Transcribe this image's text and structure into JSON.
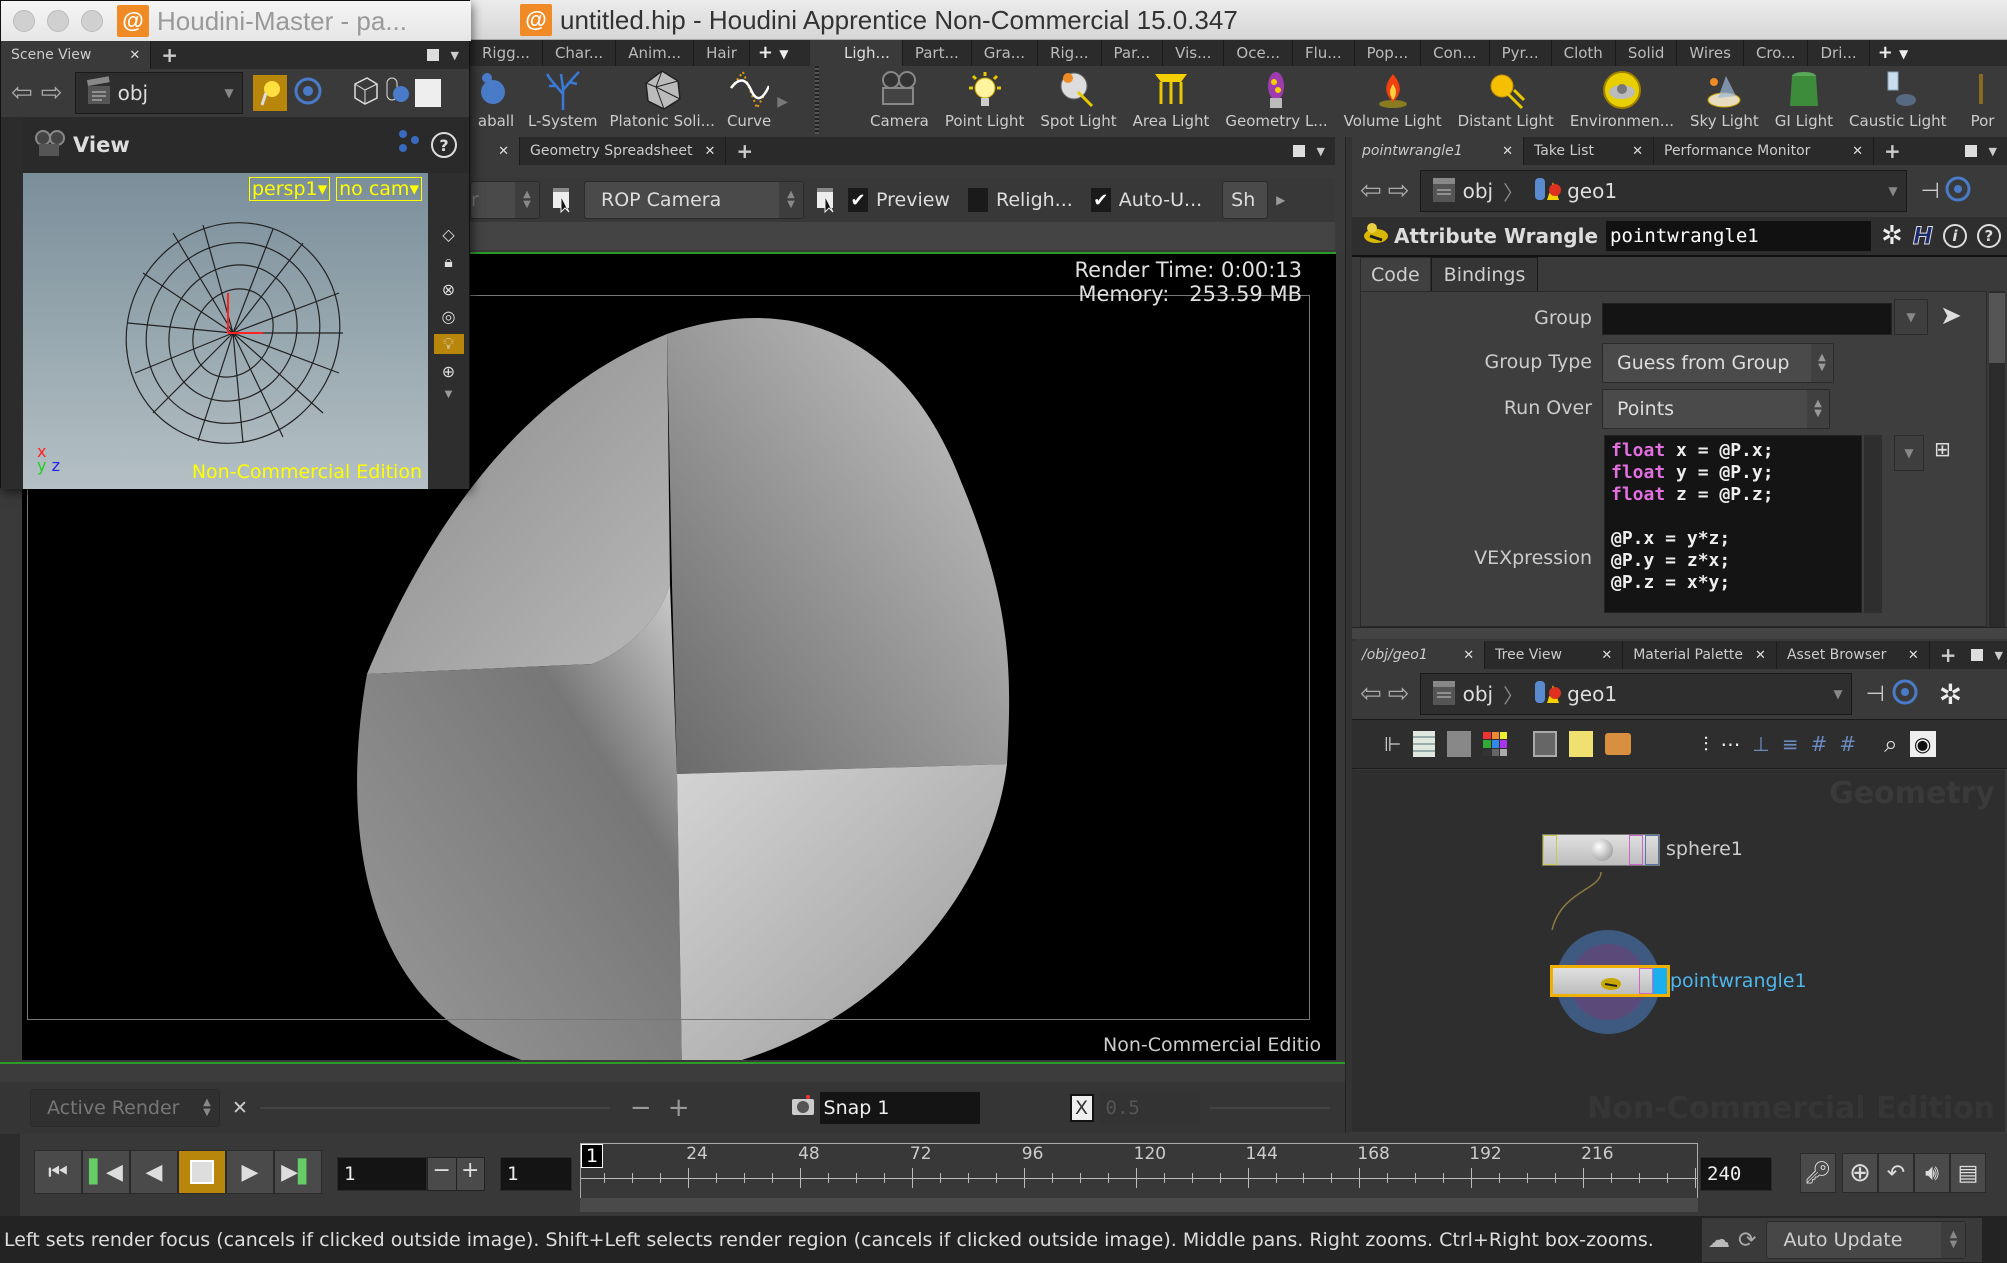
{
  "window": {
    "title": "untitled.hip - Houdini Apprentice Non-Commercial 15.0.347",
    "floating_title": "Houdini-Master - pa..."
  },
  "shelf_left": {
    "tabs": [
      "Rigg...",
      "Char...",
      "Anim...",
      "Hair"
    ],
    "tools": [
      {
        "label": "aball",
        "icon": "metaball-icon"
      },
      {
        "label": "L-System",
        "icon": "lsystem-icon"
      },
      {
        "label": "Platonic Soli...",
        "icon": "platonic-icon"
      },
      {
        "label": "Curve",
        "icon": "curve-icon"
      }
    ]
  },
  "shelf_right": {
    "tabs": [
      "Ligh...",
      "Part...",
      "Gra...",
      "Rig...",
      "Par...",
      "Vis...",
      "Oce...",
      "Flu...",
      "Pop...",
      "Con...",
      "Pyr...",
      "Cloth",
      "Solid",
      "Wires",
      "Cro...",
      "Dri..."
    ],
    "active_tab": "Ligh...",
    "tools": [
      {
        "label": "Camera",
        "icon": "camera-icon"
      },
      {
        "label": "Point Light",
        "icon": "point-light-icon"
      },
      {
        "label": "Spot Light",
        "icon": "spot-light-icon"
      },
      {
        "label": "Area Light",
        "icon": "area-light-icon"
      },
      {
        "label": "Geometry L...",
        "icon": "geometry-light-icon"
      },
      {
        "label": "Volume Light",
        "icon": "volume-light-icon"
      },
      {
        "label": "Distant Light",
        "icon": "distant-light-icon"
      },
      {
        "label": "Environmen...",
        "icon": "environment-light-icon"
      },
      {
        "label": "Sky Light",
        "icon": "sky-light-icon"
      },
      {
        "label": "GI Light",
        "icon": "gi-light-icon"
      },
      {
        "label": "Caustic Light",
        "icon": "caustic-light-icon"
      },
      {
        "label": "Por",
        "icon": "portal-light-icon"
      }
    ]
  },
  "scene_view": {
    "tab_label": "Scene View",
    "path": "obj",
    "view_label": "View",
    "camera_menu": "persp1",
    "cam_menu": "no cam",
    "watermark": "Non-Commercial Edition",
    "axes": {
      "x": "x",
      "y": "y",
      "z": "z"
    }
  },
  "render_view": {
    "tabs": [
      {
        "label": "Geometry Spreadsheet"
      }
    ],
    "renderer_combo": "r",
    "camera_combo": "ROP Camera",
    "preview_label": "Preview",
    "preview_checked": true,
    "relight_label": "Religh...",
    "relight_checked": false,
    "auto_update_label": "Auto-U...",
    "auto_update_checked": true,
    "sh_button": "Sh",
    "render_time_label": "Render Time: 0:00:13",
    "memory_label": "Memory:   253.59 MB",
    "watermark": "Non-Commercial Editio",
    "bottom": {
      "active_render": "Active Render",
      "snap_name": "Snap 1",
      "opacity_value": "0.5"
    }
  },
  "parameters": {
    "tabs": [
      {
        "label": "pointwrangle1",
        "italic": true
      },
      {
        "label": "Take List"
      },
      {
        "label": "Performance Monitor"
      }
    ],
    "path": [
      "obj",
      "geo1"
    ],
    "node_type": "Attribute Wrangle",
    "node_name": "pointwrangle1",
    "sub_tabs": [
      "Code",
      "Bindings"
    ],
    "fields": {
      "group_label": "Group",
      "group_value": "",
      "group_type_label": "Group Type",
      "group_type_value": "Guess from Group",
      "run_over_label": "Run Over",
      "run_over_value": "Points",
      "vexpression_label": "VEXpression"
    },
    "vex_lines": [
      {
        "kw": "float",
        "rest": " x = @P.x;"
      },
      {
        "kw": "float",
        "rest": " y = @P.y;"
      },
      {
        "kw": "float",
        "rest": " z = @P.z;"
      },
      {
        "kw": "",
        "rest": ""
      },
      {
        "kw": "",
        "rest": "@P.x = y*z;"
      },
      {
        "kw": "",
        "rest": "@P.y = z*x;"
      },
      {
        "kw": "",
        "rest": "@P.z = x*y;"
      }
    ]
  },
  "network": {
    "tabs": [
      {
        "label": "/obj/geo1",
        "italic": true
      },
      {
        "label": "Tree View"
      },
      {
        "label": "Material Palette"
      },
      {
        "label": "Asset Browser"
      }
    ],
    "path": [
      "obj",
      "geo1"
    ],
    "context_label": "Geometry",
    "watermark": "Non-Commercial Edition",
    "nodes": [
      {
        "name": "sphere1",
        "selected": false
      },
      {
        "name": "pointwrangle1",
        "selected": true,
        "display": true
      }
    ]
  },
  "timeline": {
    "current_frame": "1",
    "step_value": "1",
    "start_frame": "1",
    "end_frame": "240",
    "ruler_start": "1",
    "ticks": [
      "24",
      "48",
      "72",
      "96",
      "120",
      "144",
      "168",
      "192",
      "216"
    ],
    "range": [
      1,
      240
    ]
  },
  "status": {
    "message": "Left sets render focus (cancels if clicked outside image). Shift+Left selects render region (cancels if clicked outside image). Middle pans. Right zooms. Ctrl+Right box-zooms.",
    "update_mode": "Auto Update"
  },
  "colors": {
    "accent_orange": "#b8860b",
    "watermark_yellow": "#ffff00",
    "selected_node_cyan": "#4fb6ea",
    "vex_keyword": "#e26fe0",
    "render_border_green": "#2a9a2a"
  }
}
